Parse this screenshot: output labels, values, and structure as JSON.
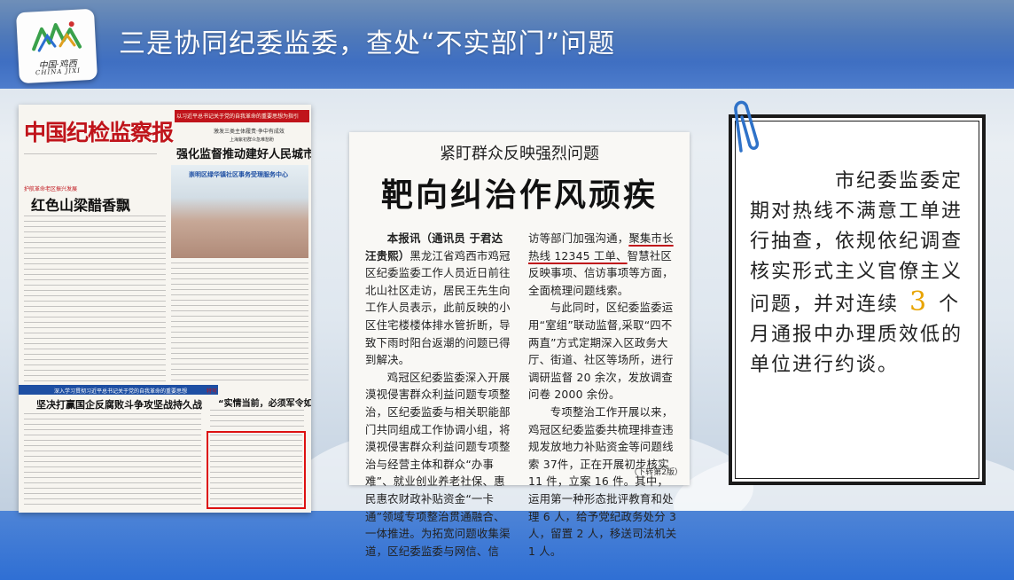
{
  "header": {
    "title": "三是协同纪委监委，查处“不实部门”问题",
    "logo_text": "中国·鸡西",
    "logo_subtext": "CHINA JIXI"
  },
  "newspaper": {
    "masthead": "中国纪检监察报",
    "top_banner": "以习近平总书记关于党的自我革命的重要思想为指引",
    "subtitle_1": "激发三类主体履责·争中有成效",
    "subtitle_2": "上海紫初群众急难愁盼",
    "headline_1": "强化监督推动建好人民城市",
    "photo_sign": "崇明区绿华镇社区事务受理服务中心",
    "section_1": "护航革命老区振兴发展",
    "headline_2": "红色山梁醋香飘",
    "band_text": "深入学习贯彻习近平总书记关于党的自我革命的重要思想",
    "headline_3": "坚决打赢国企反腐败斗争攻坚战持久战",
    "section_2": "特写",
    "headline_4": "“实情当前，必须军令如山”"
  },
  "clipping": {
    "kicker": "紧盯群众反映强烈问题",
    "headline": "靶向纠治作风顽疾",
    "col1": {
      "lead": "本报讯（通讯员 于君达 汪贵熙）",
      "p1": "黑龙江省鸡西市鸡冠区纪委监委工作人员近日前往北山社区走访，居民王先生向工作人员表示，此前反映的小区住宅楼楼体排水管折断，导致下雨时阳台返潮的问题已得到解决。",
      "p2": "鸡冠区纪委监委深入开展漠视侵害群众利益问题专项整治，区纪委监委与相关职能部门共同组成工作协调小组，将漠视侵害群众利益问题专项整治与经营主体和群众“办事难”、就业创业养老社保、惠民惠农财政补贴资金“一卡通”领域专项整治贯通融合、一体推进。为拓宽问题收集渠道，区纪委监委与网信、信"
    },
    "col2": {
      "p1_start": "访等部门加强沟通，",
      "p1_underlined": "聚集市长热线 12345 工单、",
      "p1_end": "智慧社区反映事项、信访事项等方面，全面梳理问题线索。",
      "p2": "与此同时，区纪委监委运用“室组”联动监督,采取“四不两直”方式定期深入区政务大厅、街道、社区等场所，进行调研监督 20 余次，发放调查问卷 2000 余份。",
      "p3": "专项整治工作开展以来，鸡冠区纪委监委共梳理排查违规发放地力补贴资金等问题线索 37件，正在开展初步核实 11 件，立案 16 件。其中，运用第一种形态批评教育和处理 6 人，给予党纪政务处分 3 人，留置 2 人，移送司法机关 1 人。",
      "note": "（下转第2版）"
    }
  },
  "note_card": {
    "text_before": "市纪委监委定期对热线不满意工单进行抽查，依规依纪调查核实形式主义官僚主义问题，并对连续",
    "number": "3",
    "text_after": "个月通报中办理质效低的单位进行约谈。"
  },
  "colors": {
    "header_blue": "#4f79b9",
    "bottom_blue": "#2f6fd4",
    "masthead_red": "#c0141b",
    "highlight_number": "#e8a400"
  }
}
